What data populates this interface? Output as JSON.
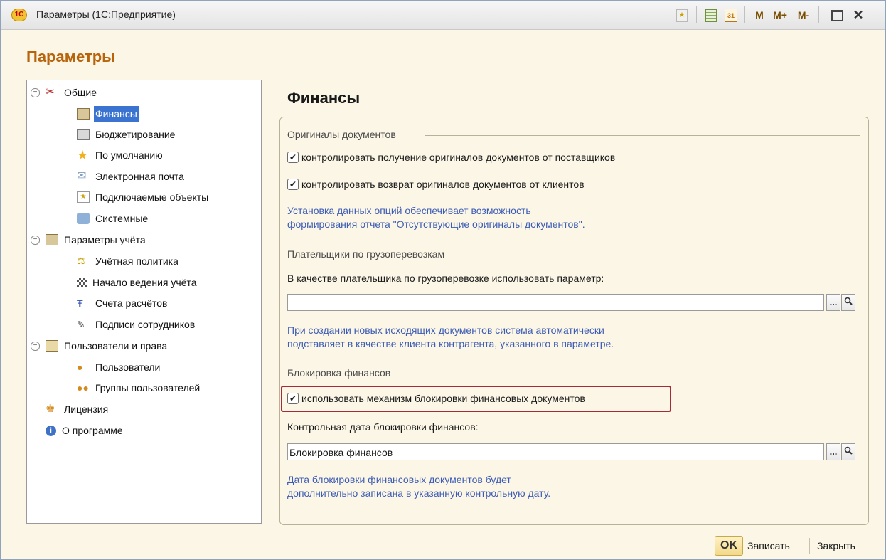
{
  "window": {
    "title": "Параметры (1С:Предприятие)",
    "logo_text": "1С",
    "toolbar": {
      "m": "M",
      "m_plus": "M+",
      "m_minus": "M-",
      "maximize": "☐",
      "close": "✕"
    }
  },
  "form": {
    "title": "Параметры"
  },
  "tree": {
    "items": [
      {
        "label": "Общие",
        "icon": "tools-icon"
      },
      {
        "label": "Финансы",
        "icon": "finance-icon"
      },
      {
        "label": "Бюджетирование",
        "icon": "calculator-icon"
      },
      {
        "label": "По умолчанию",
        "icon": "star-icon"
      },
      {
        "label": "Электронная почта",
        "icon": "envelope-icon"
      },
      {
        "label": "Подключаемые объекты",
        "icon": "plugin-icon"
      },
      {
        "label": "Системные",
        "icon": "system-icon"
      },
      {
        "label": "Параметры учёта",
        "icon": "accounting-icon"
      },
      {
        "label": "Учётная политика",
        "icon": "policy-icon"
      },
      {
        "label": "Начало ведения учёта",
        "icon": "flag-icon"
      },
      {
        "label": "Счета расчётов",
        "icon": "accounts-icon"
      },
      {
        "label": "Подписи сотрудников",
        "icon": "signature-icon"
      },
      {
        "label": "Пользователи и права",
        "icon": "users-rights-icon"
      },
      {
        "label": "Пользователи",
        "icon": "user-icon"
      },
      {
        "label": "Группы пользователей",
        "icon": "user-group-icon"
      },
      {
        "label": "Лицензия",
        "icon": "license-icon"
      },
      {
        "label": "О программе",
        "icon": "info-icon"
      }
    ]
  },
  "main": {
    "section_title": "Финансы",
    "originals": {
      "header": "Оригиналы документов",
      "check_suppliers": "контролировать получение оригиналов документов от поставщиков",
      "check_clients": "контролировать возврат оригиналов документов от клиентов",
      "note_line1": "Установка данных опций обеспечивает возможность",
      "note_line2": "формирования отчета \"Отсутствующие оригиналы документов\"."
    },
    "payers": {
      "header": "Плательщики по грузоперевозкам",
      "label": "В качестве плательщика по грузоперевозке использовать параметр:",
      "value": "",
      "note_line1": "При создании новых исходящих документов система автоматически",
      "note_line2": "подставляет в качестве клиента контрагента, указанного в параметре."
    },
    "blocking": {
      "header": "Блокировка финансов",
      "check_use": "использовать механизм блокировки финансовых документов",
      "date_label": "Контрольная дата блокировки финансов:",
      "value": "Блокировка финансов",
      "note_line1": "Дата блокировки финансовых документов будет",
      "note_line2": "дополнительно записана в указанную контрольную дату."
    },
    "select_btn": "...",
    "search_btn": "🔍"
  },
  "footer": {
    "ok": "OK",
    "save": "Записать",
    "close": "Закрыть"
  }
}
